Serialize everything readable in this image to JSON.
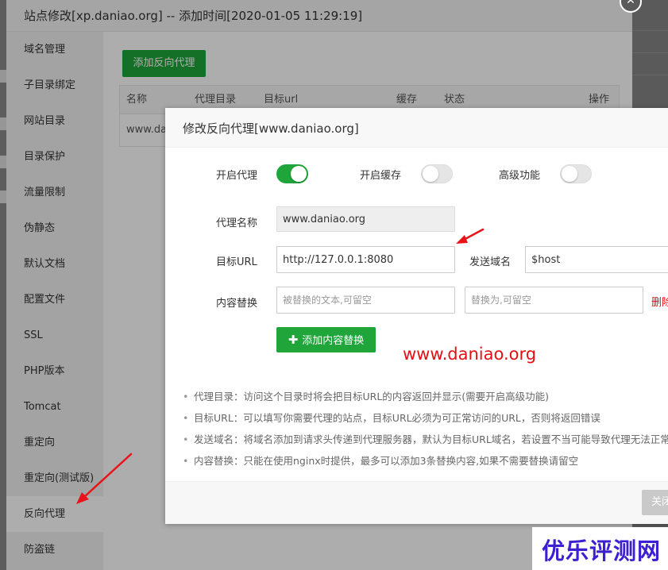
{
  "outer_dialog": {
    "title": "站点修改[xp.daniao.org] -- 添加时间[2020-01-05 11:29:19]",
    "close_symbol": "✕"
  },
  "sidebar": {
    "items": [
      {
        "label": "域名管理"
      },
      {
        "label": "子目录绑定"
      },
      {
        "label": "网站目录"
      },
      {
        "label": "目录保护"
      },
      {
        "label": "流量限制"
      },
      {
        "label": "伪静态"
      },
      {
        "label": "默认文档"
      },
      {
        "label": "配置文件"
      },
      {
        "label": "SSL"
      },
      {
        "label": "PHP版本"
      },
      {
        "label": "Tomcat"
      },
      {
        "label": "重定向"
      },
      {
        "label": "重定向(测试版)"
      },
      {
        "label": "反向代理"
      },
      {
        "label": "防盗链"
      }
    ],
    "active": "反向代理"
  },
  "content": {
    "add_proxy_button": "添加反向代理",
    "table": {
      "headers": [
        "名称",
        "代理目录",
        "目标url",
        "缓存",
        "状态",
        "操作"
      ],
      "rows": [
        [
          "www.da"
        ]
      ]
    }
  },
  "modal": {
    "title": "修改反向代理[www.daniao.org]",
    "toggles": {
      "proxy": {
        "label": "开启代理",
        "on": true
      },
      "cache": {
        "label": "开启缓存",
        "on": false
      },
      "advanced": {
        "label": "高级功能",
        "on": false
      }
    },
    "proxy_name": {
      "label": "代理名称",
      "value": "www.daniao.org"
    },
    "target_url": {
      "label": "目标URL",
      "value": "http://127.0.0.1:8080"
    },
    "send_domain": {
      "label": "发送域名",
      "value": "$host"
    },
    "content_replace": {
      "label": "内容替换",
      "from_placeholder": "被替换的文本,可留空",
      "to_placeholder": "替换为,可留空",
      "delete_label": "删除"
    },
    "add_replace_button": "添加内容替换",
    "help": [
      "代理目录：访问这个目录时将会把目标URL的内容返回并显示(需要开启高级功能)",
      "目标URL：可以填写你需要代理的站点，目标URL必须为可正常访问的URL，否则将返回错误",
      "发送域名：将域名添加到请求头传递到代理服务器，默认为目标URL域名，若设置不当可能导致代理无法正常运行",
      "内容替换：只能在使用nginx时提供，最多可以添加3条替换内容,如果不需要替换请留空"
    ],
    "close_button": "关闭"
  },
  "watermark": {
    "site": "www.daniao.org",
    "brand": "优乐评测网"
  },
  "colors": {
    "accent_green": "#20a53a",
    "arrow_red": "#e8141a",
    "delete_red": "#ef0808",
    "brand_blue": "#3b1fd1"
  }
}
